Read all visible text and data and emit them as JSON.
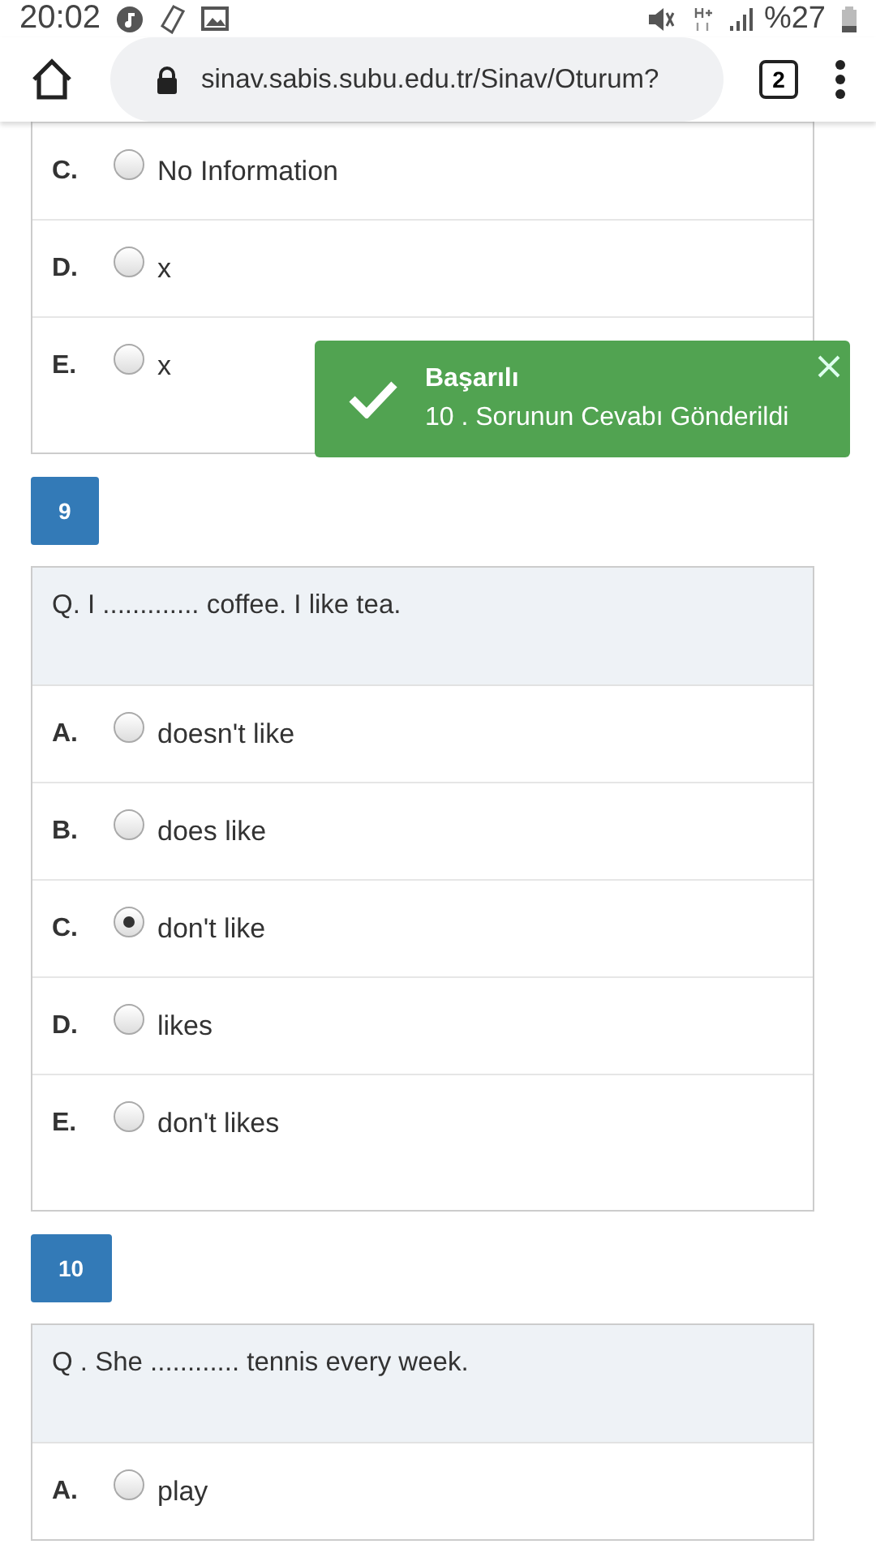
{
  "status_bar": {
    "time": "20:02",
    "battery": "%27"
  },
  "address_bar": {
    "url": "sinav.sabis.subu.edu.tr/Sinav/Oturum?",
    "tab_count": "2"
  },
  "questions": [
    {
      "options": [
        {
          "letter": "C.",
          "text": "No Information",
          "selected": false
        },
        {
          "letter": "D.",
          "text": "x",
          "selected": false
        },
        {
          "letter": "E.",
          "text": "x",
          "selected": false
        }
      ]
    },
    {
      "number": "9",
      "prompt": "Q. I ............. coffee.  I like tea.",
      "options": [
        {
          "letter": "A.",
          "text": "doesn't like",
          "selected": false
        },
        {
          "letter": "B.",
          "text": "does like",
          "selected": false
        },
        {
          "letter": "C.",
          "text": "don't like",
          "selected": true
        },
        {
          "letter": "D.",
          "text": "likes",
          "selected": false
        },
        {
          "letter": "E.",
          "text": "don't likes",
          "selected": false
        }
      ]
    },
    {
      "number": "10",
      "prompt": "Q . She ............ tennis every week.",
      "options": [
        {
          "letter": "A.",
          "text": "play",
          "selected": false
        }
      ]
    }
  ],
  "toast": {
    "title": "Başarılı",
    "message": "10 . Sorunun Cevabı Gönderildi"
  }
}
